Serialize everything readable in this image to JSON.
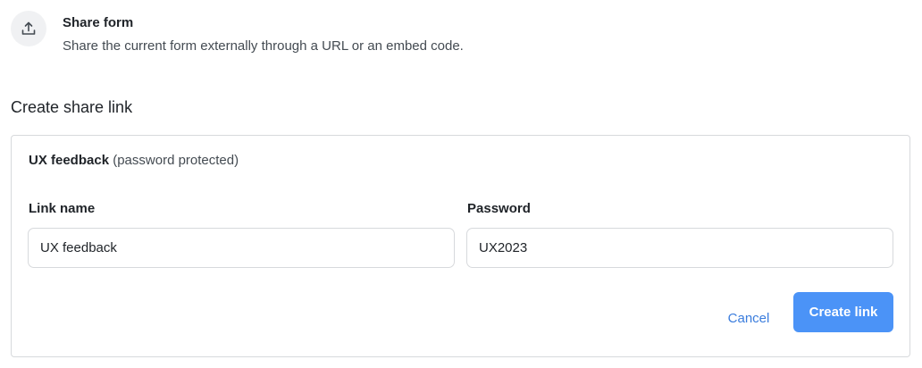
{
  "header": {
    "icon": "share-upload-icon",
    "title": "Share form",
    "description": "Share the current form externally through a URL or an embed code."
  },
  "section": {
    "title": "Create share link"
  },
  "card": {
    "link_title": "UX feedback",
    "link_note": "(password protected)",
    "fields": {
      "link_name": {
        "label": "Link name",
        "value": "UX feedback"
      },
      "password": {
        "label": "Password",
        "value": "UX2023"
      }
    },
    "actions": {
      "cancel_label": "Cancel",
      "create_label": "Create link"
    }
  },
  "colors": {
    "accent": "#4b93f7",
    "link": "#3b7ddd",
    "border": "#d7d9dc",
    "icon_bg": "#f0f1f3"
  }
}
